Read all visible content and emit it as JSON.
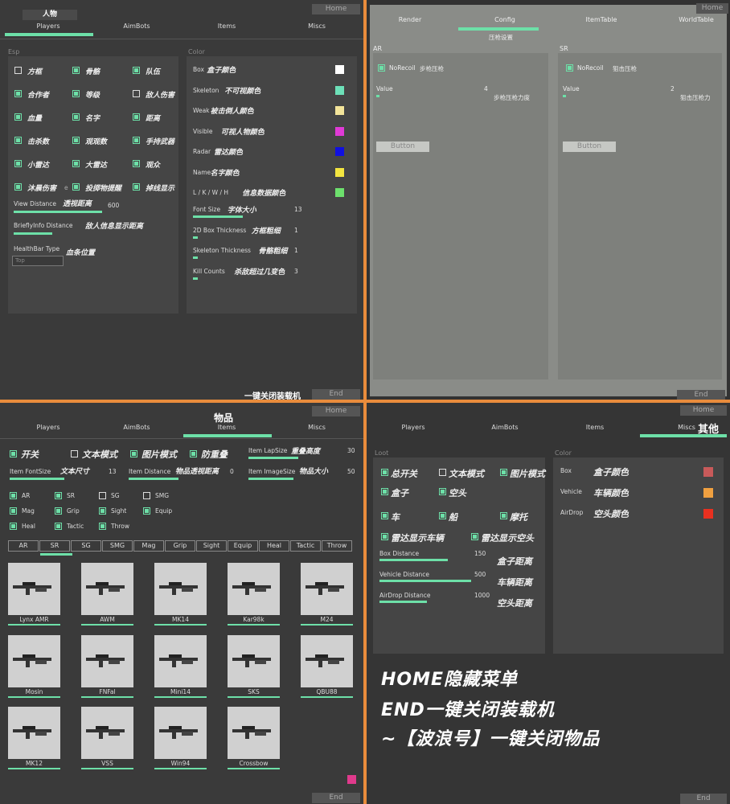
{
  "q1": {
    "home": "Home",
    "end": "End",
    "title": "人物",
    "tabs": [
      "Players",
      "AimBots",
      "Items",
      "Miscs"
    ],
    "esp_label": "Esp",
    "color_label": "Color",
    "checks": [
      {
        "label": "方框",
        "on": false
      },
      {
        "label": "骨骼",
        "on": true
      },
      {
        "label": "队伍",
        "on": true
      },
      {
        "label": "合作者",
        "on": true
      },
      {
        "label": "等级",
        "on": true
      },
      {
        "label": "敌人伤害",
        "on": false
      },
      {
        "label": "血量",
        "on": true
      },
      {
        "label": "名字",
        "on": true
      },
      {
        "label": "距离",
        "on": true
      },
      {
        "label": "击杀数",
        "on": true
      },
      {
        "label": "观观数",
        "on": true
      },
      {
        "label": "手持武器",
        "on": true
      },
      {
        "label": "小雷达",
        "on": true
      },
      {
        "label": "大雷达",
        "on": true
      },
      {
        "label": "观众",
        "on": true
      },
      {
        "label": "沐晨伤害",
        "on": true
      },
      {
        "label": "投掷物提醒",
        "on": true
      },
      {
        "label": "掉线显示",
        "on": true
      }
    ],
    "check_suffix": "e",
    "view_distance": {
      "label": "View Distance",
      "cn": "透视距离",
      "value": "600"
    },
    "briefly": {
      "label": "BrieflyInfo Distance",
      "cn": "敌人信息显示距离"
    },
    "healthbar": {
      "label": "HealthBar Type",
      "cn": "血条位置",
      "value": "Top"
    },
    "colors": [
      {
        "en": "Box",
        "cn": "盒子颜色",
        "color": "#ffffff"
      },
      {
        "en": "Skeleton",
        "cn": "不可视颜色",
        "color": "#6de0b8"
      },
      {
        "en": "Weak",
        "cn": "被击倒人颜色",
        "color": "#f3e49a"
      },
      {
        "en": "Visible",
        "cn": "可视人物颜色",
        "color": "#e03ad6"
      },
      {
        "en": "Radar",
        "cn": "雷达颜色",
        "color": "#1010e0"
      },
      {
        "en": "Name",
        "cn": "名字颜色",
        "color": "#f3e540"
      },
      {
        "en": "L / K / W / H",
        "cn": "信息数据颜色",
        "color": "#6de06d"
      }
    ],
    "sliders": [
      {
        "en": "Font Size",
        "cn": "字体大小",
        "value": "13"
      },
      {
        "en": "2D Box Thickness",
        "cn": "方框粗细",
        "value": "1"
      },
      {
        "en": "Skeleton Thickness",
        "cn": "骨骼粗细",
        "value": "1"
      },
      {
        "en": "Kill Counts",
        "cn": "杀敌超过几变色",
        "value": "3"
      }
    ],
    "footer": "一键关闭装载机"
  },
  "q2": {
    "home": "Home",
    "end": "End",
    "tabs": [
      "Render",
      "Config",
      "ItemTable",
      "WorldTable"
    ],
    "subtitle": "压枪设置",
    "ar": {
      "label": "AR",
      "norecoil": "NoRecoil",
      "cn": "步枪压枪",
      "value_label": "Value",
      "value": "4",
      "hint": "步枪压枪力度",
      "button": "Button"
    },
    "sr": {
      "label": "SR",
      "norecoil": "NoRecoil",
      "cn": "狙击压枪",
      "value_label": "Value",
      "value": "2",
      "hint": "狙击压枪力",
      "button": "Button"
    }
  },
  "q3": {
    "home": "Home",
    "end": "End",
    "title": "物品",
    "tabs": [
      "Players",
      "AimBots",
      "Items",
      "Miscs"
    ],
    "row1": [
      {
        "label": "开关",
        "on": true
      },
      {
        "label": "文本模式",
        "on": false
      },
      {
        "label": "图片模式",
        "on": true
      },
      {
        "label": "防重叠",
        "on": true
      }
    ],
    "lapsize": {
      "en": "Item LapSize",
      "cn": "重叠高度",
      "value": "30"
    },
    "fontsize": {
      "en": "Item FontSize",
      "cn": "文本尺寸",
      "value": "13"
    },
    "distance": {
      "en": "Item Distance",
      "cn": "物品透视距离",
      "value": "0"
    },
    "imagesize": {
      "en": "Item ImageSize",
      "cn": "物品大小",
      "value": "50"
    },
    "cats": [
      {
        "label": "AR",
        "on": true
      },
      {
        "label": "SR",
        "on": true
      },
      {
        "label": "SG",
        "on": false
      },
      {
        "label": "SMG",
        "on": false
      },
      {
        "label": "Mag",
        "on": true
      },
      {
        "label": "Grip",
        "on": true
      },
      {
        "label": "Sight",
        "on": true
      },
      {
        "label": "Equip",
        "on": true
      },
      {
        "label": "Heal",
        "on": true
      },
      {
        "label": "Tactic",
        "on": true
      },
      {
        "label": "Throw",
        "on": true
      }
    ],
    "ctabs": [
      "AR",
      "SR",
      "SG",
      "SMG",
      "Mag",
      "Grip",
      "Sight",
      "Equip",
      "Heal",
      "Tactic",
      "Throw"
    ],
    "weapons": [
      "Lynx AMR",
      "AWM",
      "MK14",
      "Kar98k",
      "M24",
      "Mosin",
      "FNFal",
      "Mini14",
      "SKS",
      "QBU88",
      "MK12",
      "VSS",
      "Win94",
      "Crossbow"
    ],
    "accent": "#e03a8c"
  },
  "q4": {
    "home": "Home",
    "end": "End",
    "tabs": [
      "Players",
      "AimBots",
      "Items",
      "Miscs"
    ],
    "tab_cn": "其他",
    "loot_label": "Loot",
    "color_label": "Color",
    "checks": [
      {
        "label": "总开关",
        "on": true
      },
      {
        "label": "文本模式",
        "on": false
      },
      {
        "label": "图片模式",
        "on": true
      },
      {
        "label": "盒子",
        "on": true
      },
      {
        "label": "空头",
        "on": true
      },
      {
        "label": "车",
        "on": true
      },
      {
        "label": "船",
        "on": true
      },
      {
        "label": "摩托",
        "on": true
      },
      {
        "label": "雷达显示车辆",
        "on": true
      },
      {
        "label": "雷达显示空头",
        "on": true
      }
    ],
    "dists": [
      {
        "en": "Box Distance",
        "value": "150",
        "cn": "盒子距离"
      },
      {
        "en": "Vehicle Distance",
        "value": "500",
        "cn": "车辆距离"
      },
      {
        "en": "AirDrop Distance",
        "value": "1000",
        "cn": "空头距离"
      }
    ],
    "colors": [
      {
        "en": "Box",
        "cn": "盒子颜色",
        "color": "#c85a5a"
      },
      {
        "en": "Vehicle",
        "cn": "车辆颜色",
        "color": "#f0a040"
      },
      {
        "en": "AirDrop",
        "cn": "空头颜色",
        "color": "#e83020"
      }
    ],
    "notes": [
      "HOME隐藏菜单",
      "END一键关闭装载机",
      "~【波浪号】一键关闭物品"
    ]
  }
}
